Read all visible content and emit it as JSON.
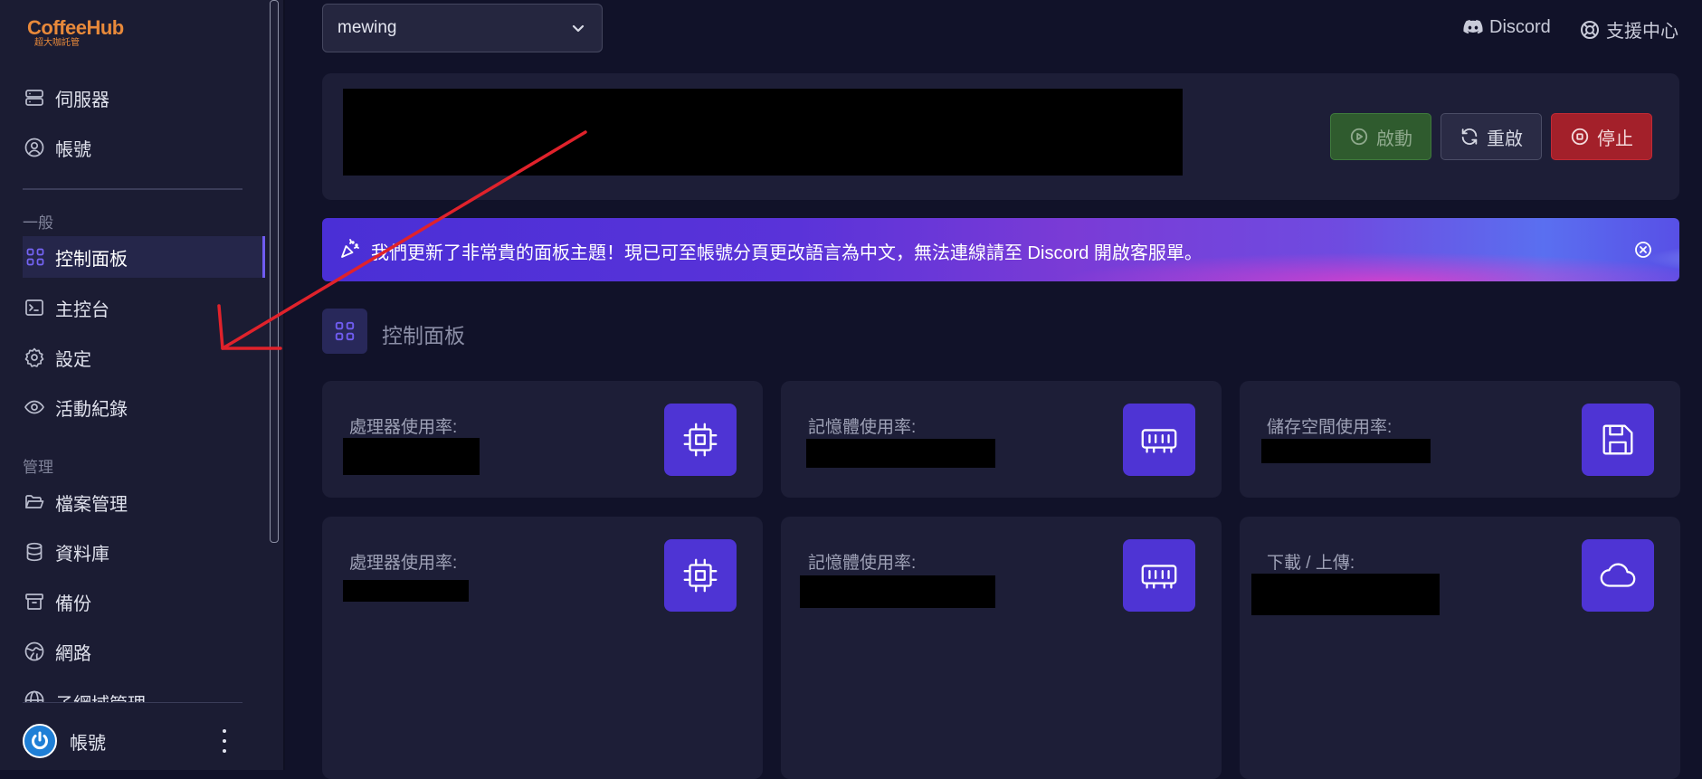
{
  "brand": {
    "name": "CoffeeHub",
    "subtitle": "超大咖託管"
  },
  "sidebar": {
    "top_items": [
      {
        "label": "伺服器",
        "icon": "server-icon"
      },
      {
        "label": "帳號",
        "icon": "user-circle-icon"
      }
    ],
    "sections": [
      {
        "title": "一般",
        "items": [
          {
            "label": "控制面板",
            "icon": "dashboard-icon",
            "active": true
          },
          {
            "label": "主控台",
            "icon": "terminal-icon"
          },
          {
            "label": "設定",
            "icon": "gear-icon"
          },
          {
            "label": "活動紀錄",
            "icon": "eye-icon"
          }
        ]
      },
      {
        "title": "管理",
        "items": [
          {
            "label": "檔案管理",
            "icon": "folder-icon"
          },
          {
            "label": "資料庫",
            "icon": "database-icon"
          },
          {
            "label": "備份",
            "icon": "archive-icon"
          },
          {
            "label": "網路",
            "icon": "globe-network-icon"
          },
          {
            "label": "子網域管理",
            "icon": "globe-icon"
          }
        ]
      }
    ],
    "user": {
      "label": "帳號"
    }
  },
  "topbar": {
    "server_select": "mewing",
    "discord": "Discord",
    "support": "支援中心"
  },
  "controls": {
    "start": "啟動",
    "restart": "重啟",
    "stop": "停止"
  },
  "banner": {
    "text": "我們更新了非常貴的面板主題！現已可至帳號分頁更改語言為中文，無法連線請至 Discord 開啟客服單。"
  },
  "dashboard": {
    "title": "控制面板",
    "cards": [
      {
        "label": "處理器使用率:",
        "icon": "cpu-icon"
      },
      {
        "label": "記憶體使用率:",
        "icon": "memory-icon"
      },
      {
        "label": "儲存空間使用率:",
        "icon": "save-icon"
      },
      {
        "label": "處理器使用率:",
        "icon": "cpu-icon"
      },
      {
        "label": "記憶體使用率:",
        "icon": "memory-icon"
      },
      {
        "label": "下載 / 上傳:",
        "icon": "cloud-icon"
      }
    ]
  },
  "colors": {
    "background": "#111229",
    "sidebar": "#1b1c33",
    "card": "#1d1e37",
    "accent": "#4e34d4",
    "brand": "#e8893a",
    "start": "#2f5b2e",
    "stop": "#a3202a",
    "annotation": "#e0222b"
  }
}
